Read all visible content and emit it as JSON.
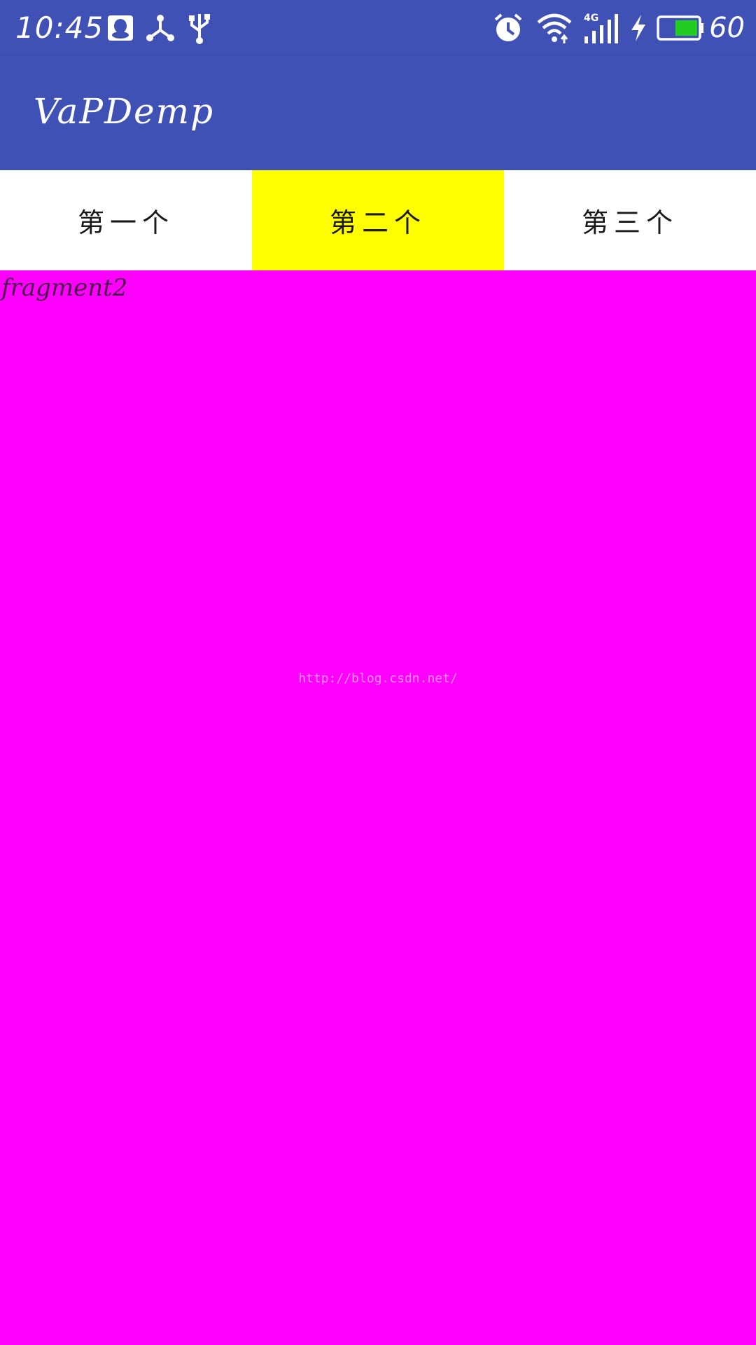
{
  "status_bar": {
    "time": "10:45",
    "battery_percent": "60",
    "network_label": "4G",
    "left_icons": [
      "qq-icon",
      "share-icon",
      "usb-icon"
    ],
    "right_icons": [
      "alarm-icon",
      "wifi-icon",
      "signal-icon",
      "charging-icon",
      "battery-icon"
    ],
    "battery_fill_fraction": 0.6,
    "battery_color": "#22cc22"
  },
  "app_bar": {
    "title": "VaPDemp",
    "background": "#3f51b5"
  },
  "tabs": [
    {
      "label": "第一个",
      "selected": false
    },
    {
      "label": "第二个",
      "selected": true
    },
    {
      "label": "第三个",
      "selected": false
    }
  ],
  "content": {
    "fragment_text": "fragment2",
    "watermark": "http://blog.csdn.net/",
    "background": "#ff00ff"
  },
  "colors": {
    "primary": "#3f51b5",
    "selected_tab": "#ffff00",
    "content": "#ff00ff"
  }
}
